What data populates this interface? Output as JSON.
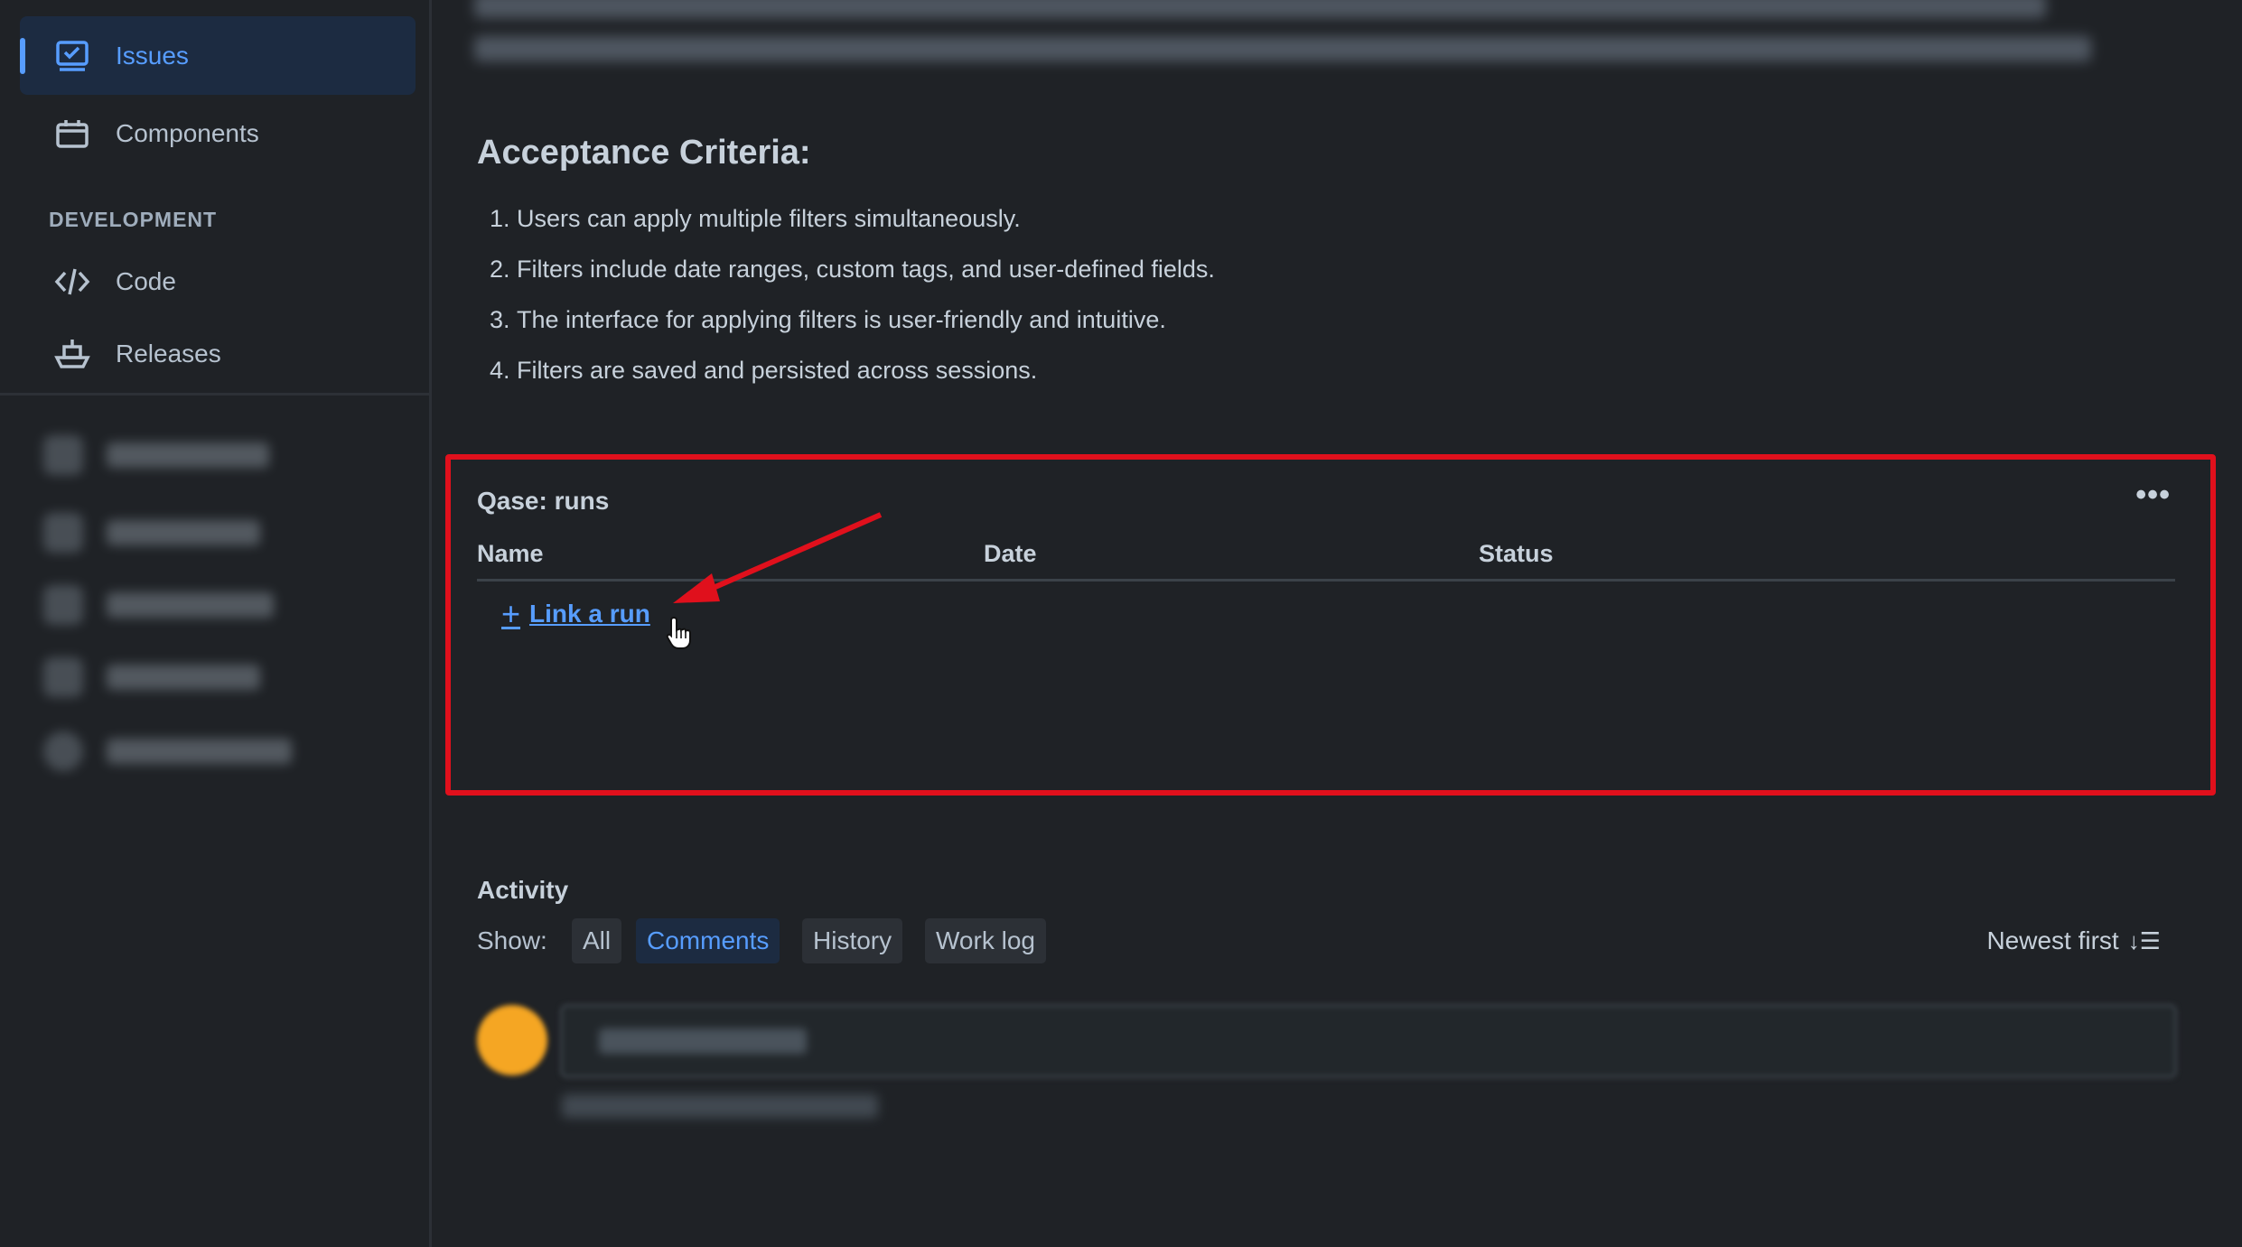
{
  "sidebar": {
    "items": [
      {
        "label": "Issues",
        "icon": "issues-icon",
        "active": true
      },
      {
        "label": "Components",
        "icon": "components-icon",
        "active": false
      }
    ],
    "section_label": "DEVELOPMENT",
    "dev_items": [
      {
        "label": "Code",
        "icon": "code-icon"
      },
      {
        "label": "Releases",
        "icon": "releases-icon"
      }
    ]
  },
  "content": {
    "acceptance_heading": "Acceptance Criteria:",
    "criteria": [
      {
        "num": "1.",
        "text": "Users can apply multiple filters simultaneously."
      },
      {
        "num": "2.",
        "text": "Filters include date ranges, custom tags, and user-defined fields."
      },
      {
        "num": "3.",
        "text": "The interface for applying filters is user-friendly and intuitive."
      },
      {
        "num": "4.",
        "text": "Filters are saved and persisted across sessions."
      }
    ]
  },
  "qase": {
    "title": "Qase: runs",
    "more": "•••",
    "columns": {
      "name": "Name",
      "date": "Date",
      "status": "Status"
    },
    "link_run": "Link a run",
    "link_plus": "+"
  },
  "activity": {
    "title": "Activity",
    "show_label": "Show:",
    "filters": [
      {
        "label": "All",
        "selected": false
      },
      {
        "label": "Comments",
        "selected": true
      },
      {
        "label": "History",
        "selected": false
      },
      {
        "label": "Work log",
        "selected": false
      }
    ],
    "sort_label": "Newest first",
    "sort_icon": "↓☰"
  },
  "colors": {
    "background": "#1f2226",
    "accent": "#579dff",
    "highlight_border": "#e0101c",
    "avatar": "#f5a623"
  }
}
